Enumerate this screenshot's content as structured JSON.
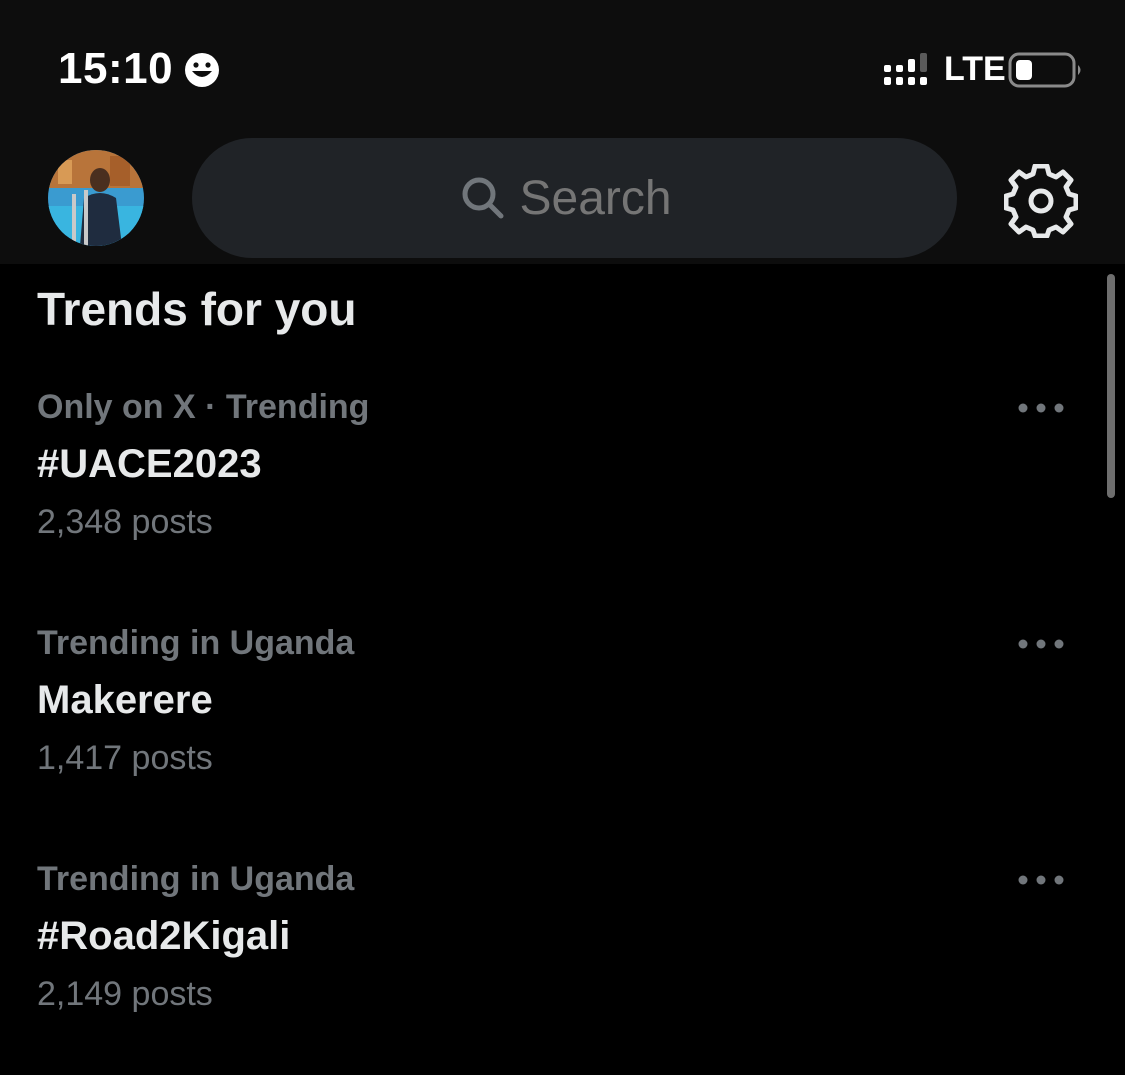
{
  "status_bar": {
    "time": "15:10",
    "network": "LTE",
    "emoji_icon": "smiley-icon",
    "signal_icon": "signal-icon",
    "battery_icon": "battery-icon"
  },
  "header": {
    "search": {
      "placeholder": "Search"
    },
    "avatar_icon": "avatar",
    "settings_icon": "gear-icon"
  },
  "trends": {
    "title": "Trends for you",
    "items": [
      {
        "context": "Only on X · Trending",
        "name": "#UACE2023",
        "count": "2,348 posts"
      },
      {
        "context": "Trending in Uganda",
        "name": "Makerere",
        "count": "1,417 posts"
      },
      {
        "context": "Trending in Uganda",
        "name": "#Road2Kigali",
        "count": "2,149 posts"
      }
    ]
  },
  "colors": {
    "background": "#000000",
    "header_background": "#0d0d0d",
    "search_background": "#202327",
    "primary_text": "#e7e9ea",
    "secondary_text": "#71767b"
  }
}
